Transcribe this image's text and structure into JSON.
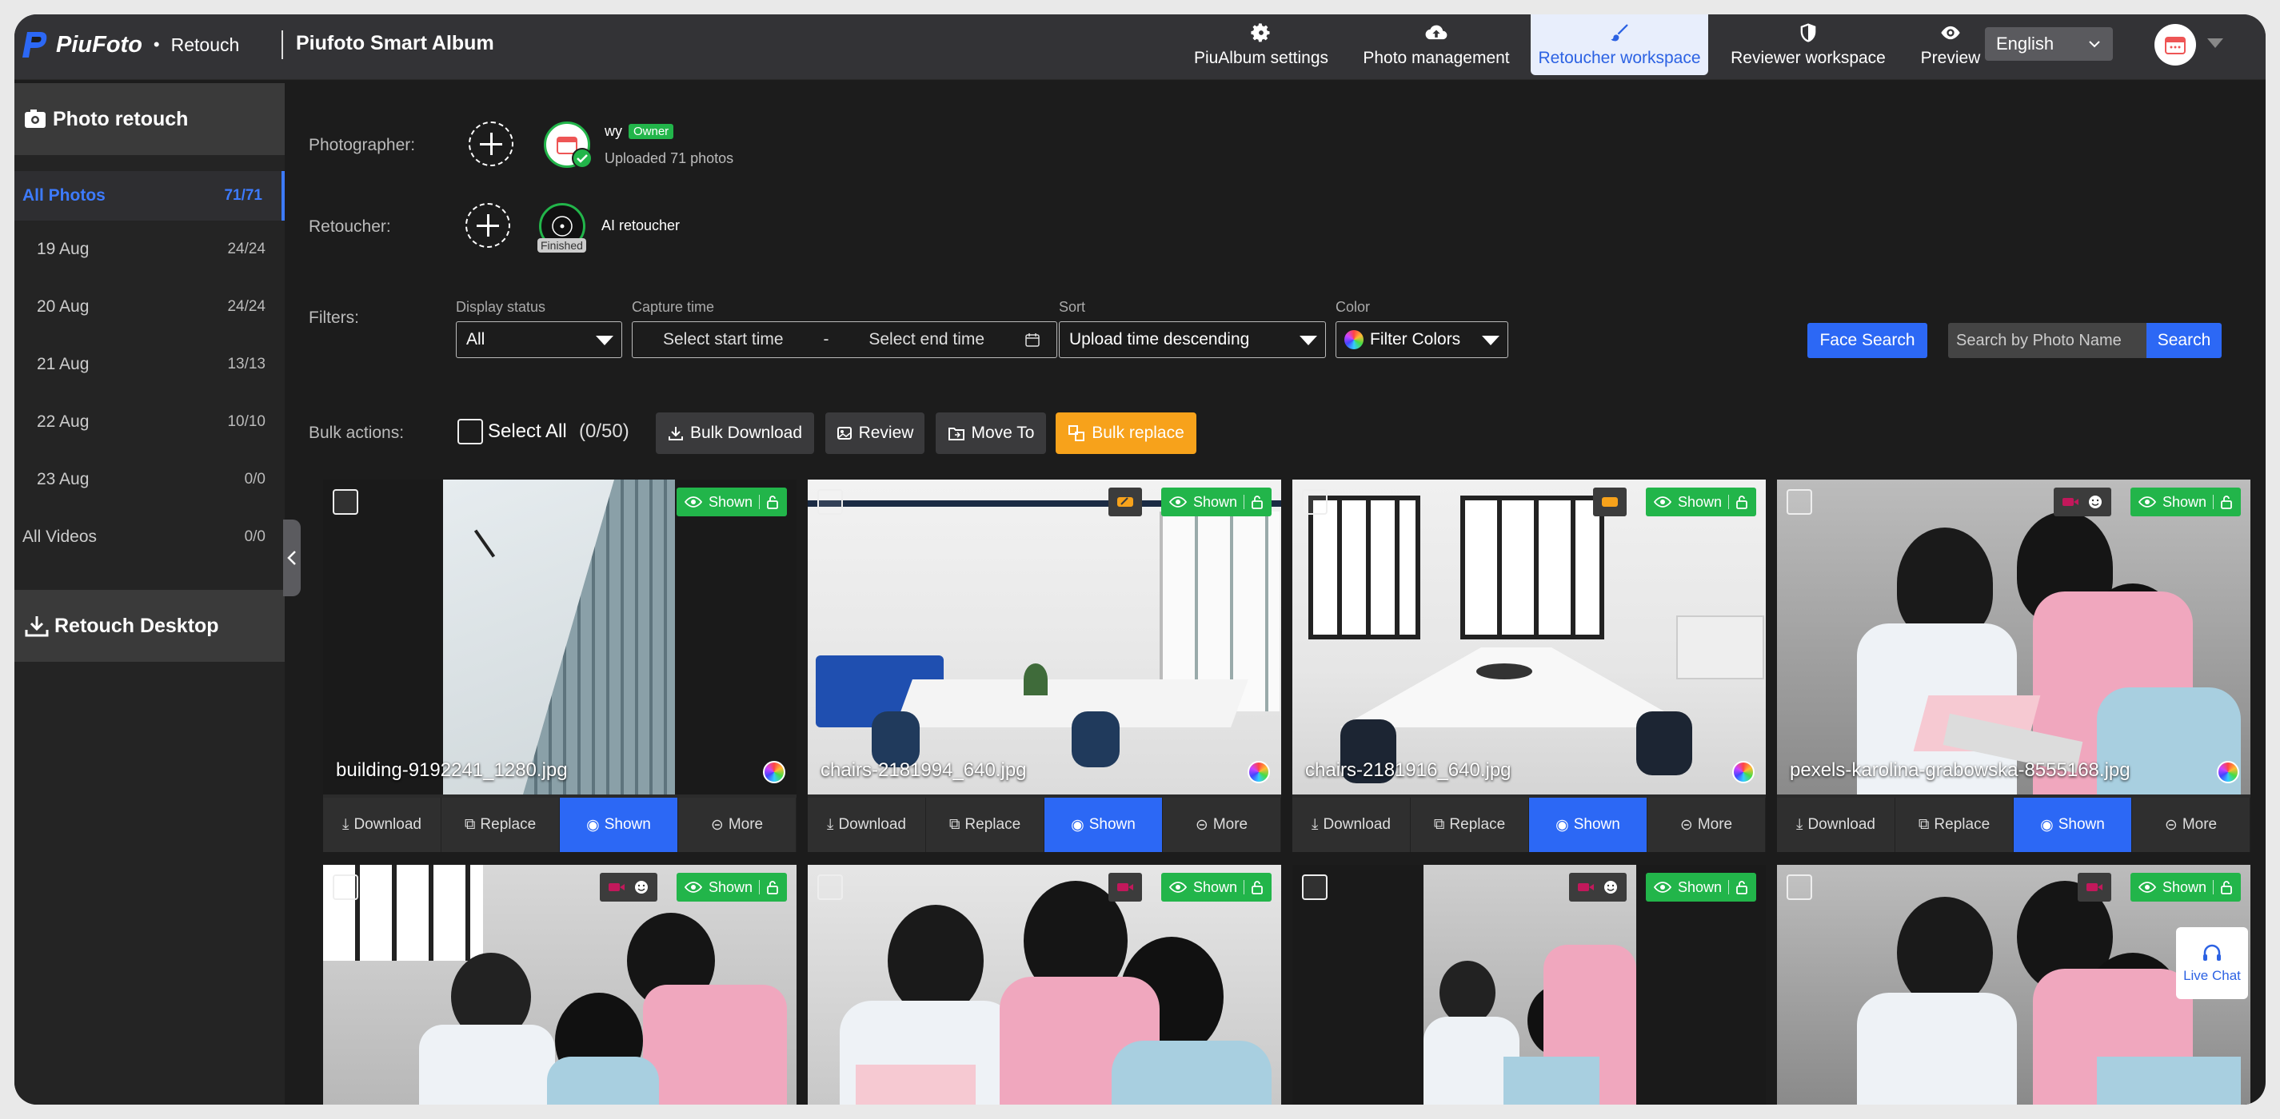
{
  "app": {
    "brand": "PiuFoto",
    "sub": "Retouch",
    "album_title": "Piufoto Smart Album"
  },
  "nav": [
    {
      "label": "PiuAlbum settings",
      "icon": "gear-icon"
    },
    {
      "label": "Photo management",
      "icon": "cloud-upload-icon"
    },
    {
      "label": "Retoucher workspace",
      "icon": "brush-icon",
      "active": true
    },
    {
      "label": "Reviewer workspace",
      "icon": "shield-icon"
    },
    {
      "label": "Preview",
      "icon": "eye-icon"
    }
  ],
  "language": "English",
  "sidebar": {
    "header": "Photo retouch",
    "all": {
      "label": "All Photos",
      "count": "71/71"
    },
    "days": [
      {
        "label": "19 Aug",
        "count": "24/24"
      },
      {
        "label": "20 Aug",
        "count": "24/24"
      },
      {
        "label": "21 Aug",
        "count": "13/13"
      },
      {
        "label": "22 Aug",
        "count": "10/10"
      },
      {
        "label": "23 Aug",
        "count": "0/0"
      }
    ],
    "videos": {
      "label": "All Videos",
      "count": "0/0"
    },
    "desktop": "Retouch Desktop"
  },
  "photographer": {
    "label": "Photographer:",
    "name": "wy",
    "role": "Owner",
    "uploaded": "Uploaded 71 photos"
  },
  "retoucher": {
    "label": "Retoucher:",
    "name": "AI retoucher",
    "status": "Finished"
  },
  "filters": {
    "label": "Filters:",
    "display_status": {
      "label": "Display status",
      "value": "All"
    },
    "capture_time": {
      "label": "Capture time",
      "start": "Select start time",
      "dash": "-",
      "end": "Select end time"
    },
    "sort": {
      "label": "Sort",
      "value": "Upload time descending"
    },
    "color": {
      "label": "Color",
      "value": "Filter Colors"
    },
    "face_search": "Face Search",
    "search_placeholder": "Search by Photo Name",
    "search_button": "Search"
  },
  "bulk": {
    "label": "Bulk actions:",
    "select_all": "Select All",
    "selected": "(0/50)",
    "download": "Bulk Download",
    "review": "Review",
    "move": "Move To",
    "replace": "Bulk replace"
  },
  "card_actions": {
    "download": "Download",
    "replace": "Replace",
    "shown": "Shown",
    "more": "More"
  },
  "badge": {
    "shown": "Shown"
  },
  "photos": [
    {
      "name": "building-9192241_1280.jpg"
    },
    {
      "name": "chairs-2181994_640.jpg"
    },
    {
      "name": "chairs-2181916_640.jpg"
    },
    {
      "name": "pexels-karolina-grabowska-8555168.jpg"
    },
    {
      "name": ""
    },
    {
      "name": ""
    },
    {
      "name": ""
    },
    {
      "name": ""
    }
  ],
  "live_chat": "Live Chat",
  "colors": {
    "accent": "#2c68f5",
    "shown_green": "#22b54a",
    "orange": "#f7a21b",
    "video_pink": "#c2185b"
  }
}
